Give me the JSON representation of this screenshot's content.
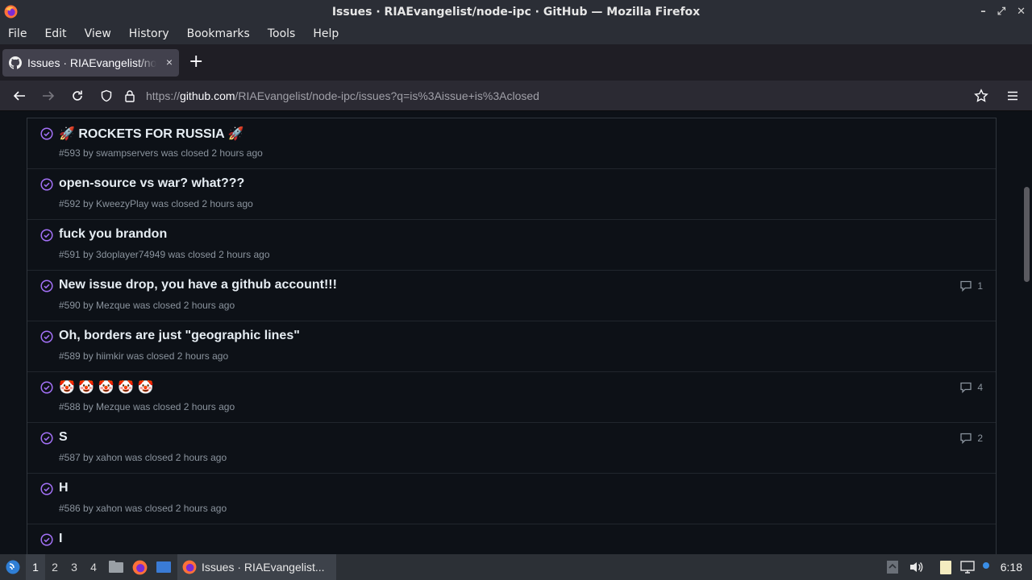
{
  "window": {
    "title": "Issues · RIAEvangelist/node-ipc · GitHub — Mozilla Firefox",
    "controls": [
      "–",
      "⤢",
      "✕"
    ]
  },
  "menu": [
    "File",
    "Edit",
    "View",
    "History",
    "Bookmarks",
    "Tools",
    "Help"
  ],
  "tab": {
    "title": "Issues · RIAEvangelist/node-ipc · GitHub",
    "close": "×",
    "new_tab": "+"
  },
  "url": {
    "scheme": "https://",
    "host": "github.com",
    "path": "/RIAEvangelist/node-ipc/issues?q=is%3Aissue+is%3Aclosed"
  },
  "issues": [
    {
      "title": "🚀 ROCKETS FOR RUSSIA 🚀",
      "meta": "#593 by swampservers was closed 2 hours ago",
      "comments": ""
    },
    {
      "title": "open-source vs war? what???",
      "meta": "#592 by KweezyPlay was closed 2 hours ago",
      "comments": ""
    },
    {
      "title": "fuck you brandon",
      "meta": "#591 by 3doplayer74949 was closed 2 hours ago",
      "comments": ""
    },
    {
      "title": "New issue drop, you have a github account!!!",
      "meta": "#590 by Mezque was closed 2 hours ago",
      "comments": "1"
    },
    {
      "title": "Oh, borders are just \"geographic lines\"",
      "meta": "#589 by hiimkir was closed 2 hours ago",
      "comments": ""
    },
    {
      "title": "🤡 🤡 🤡 🤡 🤡",
      "meta": "#588 by Mezque was closed 2 hours ago",
      "comments": "4"
    },
    {
      "title": "S",
      "meta": "#587 by xahon was closed 2 hours ago",
      "comments": "2"
    },
    {
      "title": "H",
      "meta": "#586 by xahon was closed 2 hours ago",
      "comments": ""
    },
    {
      "title": "I",
      "meta": "",
      "comments": ""
    }
  ],
  "taskbar": {
    "workspaces": [
      "1",
      "2",
      "3",
      "4"
    ],
    "task_title": "Issues · RIAEvangelist...",
    "clock": "6:18"
  }
}
